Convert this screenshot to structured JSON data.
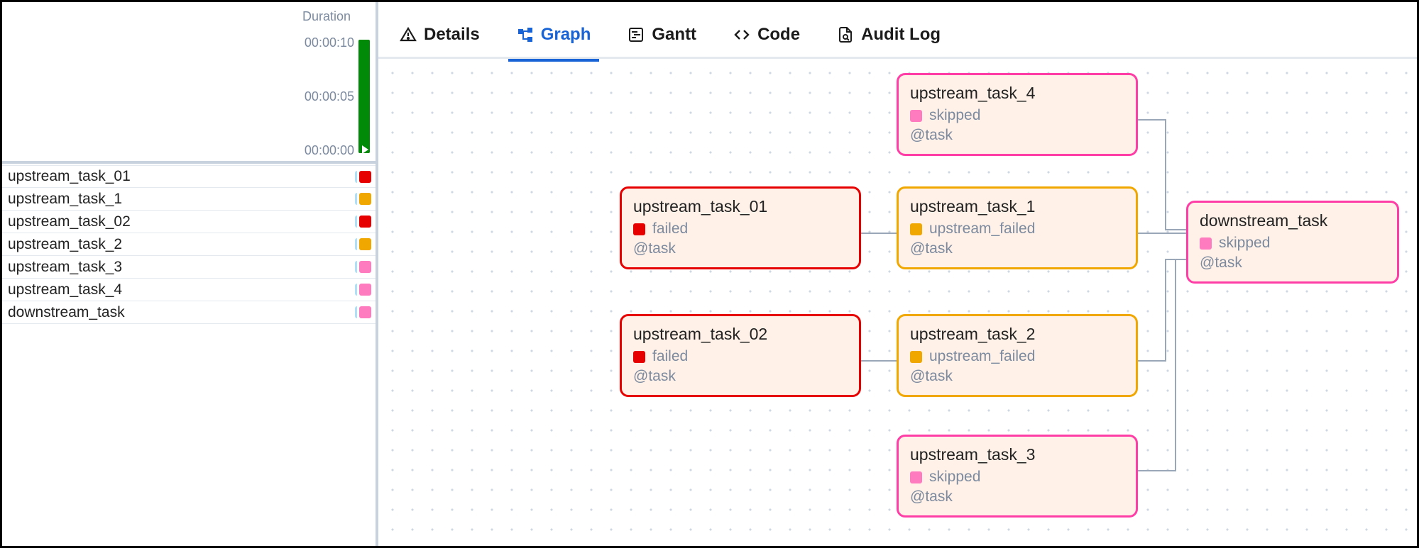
{
  "sidebar": {
    "duration_label": "Duration",
    "ticks": [
      "00:00:10",
      "00:00:05",
      "00:00:00"
    ],
    "tasks": [
      {
        "name": "upstream_task_01",
        "status": "failed"
      },
      {
        "name": "upstream_task_1",
        "status": "upstream_failed"
      },
      {
        "name": "upstream_task_02",
        "status": "failed"
      },
      {
        "name": "upstream_task_2",
        "status": "upstream_failed"
      },
      {
        "name": "upstream_task_3",
        "status": "skipped"
      },
      {
        "name": "upstream_task_4",
        "status": "skipped"
      },
      {
        "name": "downstream_task",
        "status": "skipped"
      }
    ]
  },
  "tabs": {
    "details": "Details",
    "graph": "Graph",
    "gantt": "Gantt",
    "code": "Code",
    "auditlog": "Audit Log",
    "active": "graph"
  },
  "status_labels": {
    "failed": "failed",
    "upstream_failed": "upstream_failed",
    "skipped": "skipped"
  },
  "operator_label": "@task",
  "graph": {
    "nodes": {
      "u4": {
        "title": "upstream_task_4",
        "status": "skipped",
        "col": 1,
        "row": 0
      },
      "u01": {
        "title": "upstream_task_01",
        "status": "failed",
        "col": 0,
        "row": 1
      },
      "u1": {
        "title": "upstream_task_1",
        "status": "upstream_failed",
        "col": 1,
        "row": 1
      },
      "d": {
        "title": "downstream_task",
        "status": "skipped",
        "col": 2,
        "row": 1
      },
      "u02": {
        "title": "upstream_task_02",
        "status": "failed",
        "col": 0,
        "row": 2
      },
      "u2": {
        "title": "upstream_task_2",
        "status": "upstream_failed",
        "col": 1,
        "row": 2
      },
      "u3": {
        "title": "upstream_task_3",
        "status": "skipped",
        "col": 1,
        "row": 3
      }
    }
  },
  "colors": {
    "failed": "#e60000",
    "upstream_failed": "#f0a800",
    "skipped": "#ff7bc0",
    "skipped_border": "#ff3da6",
    "accent": "#1864d6",
    "run_bar": "#018a08"
  }
}
